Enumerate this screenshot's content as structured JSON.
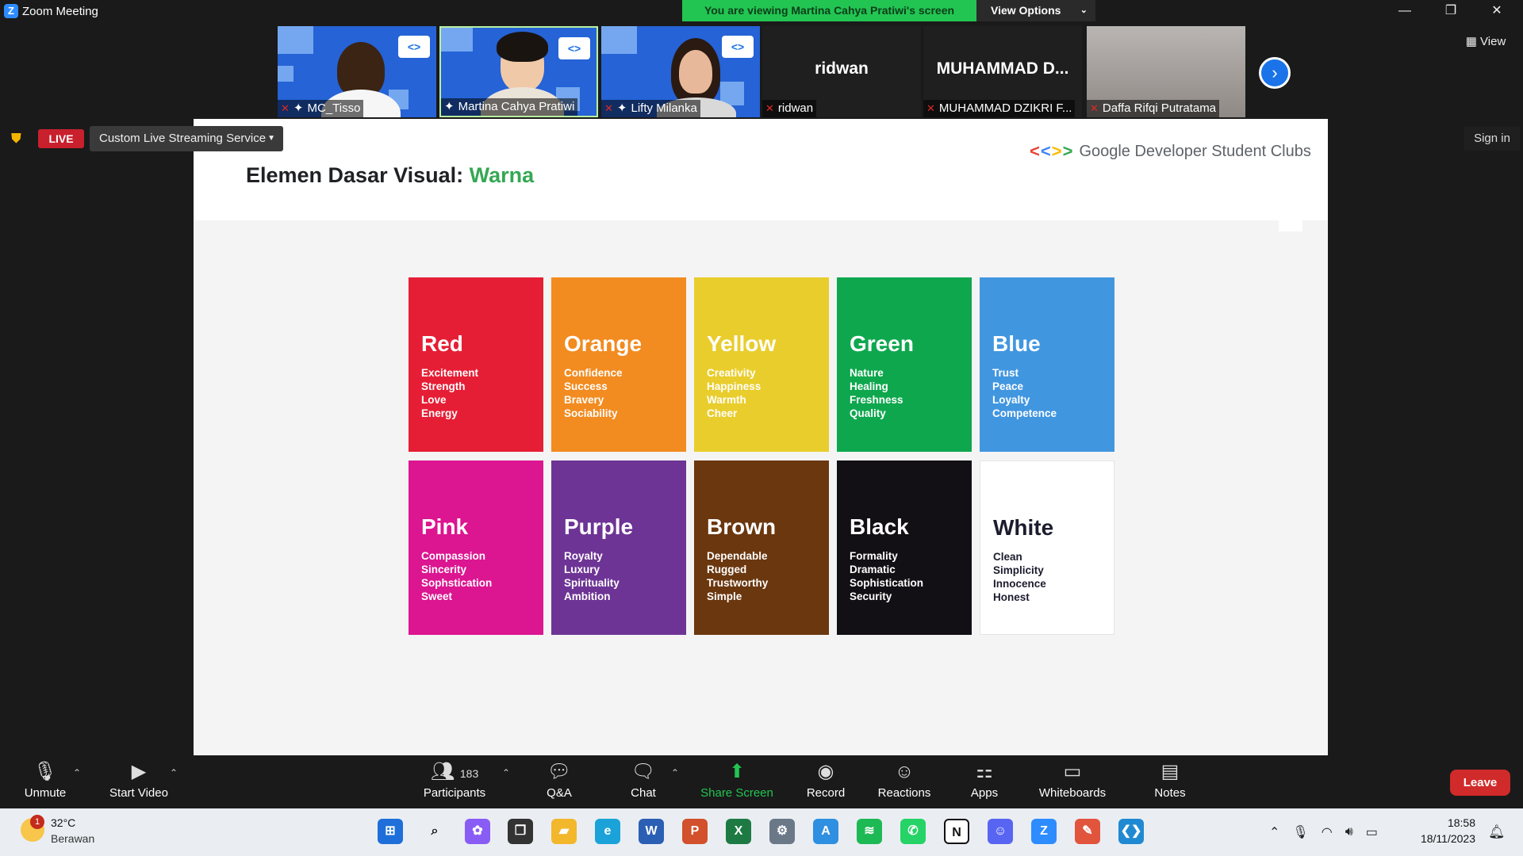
{
  "window": {
    "title": "Zoom Meeting",
    "logo": "Z"
  },
  "banner": {
    "viewing": "You are viewing Martina Cahya Pratiwi's screen",
    "view_options": "View Options"
  },
  "window_controls": {
    "minimize": "—",
    "restore": "❐",
    "close": "✕"
  },
  "thumbnails": [
    {
      "name": "MC_Tisso",
      "kind": "video"
    },
    {
      "name": "Martina Cahya Pratiwi",
      "kind": "video"
    },
    {
      "name": "Lifty Milanka",
      "kind": "video"
    },
    {
      "name": "ridwan",
      "display": "ridwan",
      "kind": "name"
    },
    {
      "name": "MUHAMMAD DZIKRI F...",
      "display": "MUHAMMAD D...",
      "kind": "name"
    },
    {
      "name": "Daffa Rifqi Putratama",
      "kind": "blurred"
    }
  ],
  "view_button": "View",
  "live": {
    "badge": "LIVE",
    "service": "Custom Live Streaming Service"
  },
  "sign_in": "Sign in",
  "slide": {
    "title_prefix": "Elemen Dasar Visual: ",
    "title_accent": "Warna",
    "brand": "Google Developer Student Clubs",
    "colors": [
      {
        "name": "Red",
        "bg": "#e61e35",
        "fg": "#ffffff",
        "traits": [
          "Excitement",
          "Strength",
          "Love",
          "Energy"
        ]
      },
      {
        "name": "Orange",
        "bg": "#f28b20",
        "fg": "#ffffff",
        "traits": [
          "Confidence",
          "Success",
          "Bravery",
          "Sociability"
        ]
      },
      {
        "name": "Yellow",
        "bg": "#e9cd2c",
        "fg": "#ffffff",
        "traits": [
          "Creativity",
          "Happiness",
          "Warmth",
          "Cheer"
        ]
      },
      {
        "name": "Green",
        "bg": "#0ea74e",
        "fg": "#ffffff",
        "traits": [
          "Nature",
          "Healing",
          "Freshness",
          "Quality"
        ]
      },
      {
        "name": "Blue",
        "bg": "#4196e0",
        "fg": "#ffffff",
        "traits": [
          "Trust",
          "Peace",
          "Loyalty",
          "Competence"
        ]
      },
      {
        "name": "Pink",
        "bg": "#dc1591",
        "fg": "#ffffff",
        "traits": [
          "Compassion",
          "Sincerity",
          "Sophstication",
          "Sweet"
        ]
      },
      {
        "name": "Purple",
        "bg": "#6d3495",
        "fg": "#ffffff",
        "traits": [
          "Royalty",
          "Luxury",
          "Spirituality",
          "Ambition"
        ]
      },
      {
        "name": "Brown",
        "bg": "#6b370f",
        "fg": "#ffffff",
        "traits": [
          "Dependable",
          "Rugged",
          "Trustworthy",
          "Simple"
        ]
      },
      {
        "name": "Black",
        "bg": "#121015",
        "fg": "#ffffff",
        "traits": [
          "Formality",
          "Dramatic",
          "Sophistication",
          "Security"
        ]
      },
      {
        "name": "White",
        "bg": "#ffffff",
        "fg": "#1c1c2e",
        "traits": [
          "Clean",
          "Simplicity",
          "Innocence",
          "Honest"
        ]
      }
    ]
  },
  "toolbar": {
    "unmute": "Unmute",
    "start_video": "Start Video",
    "participants": "Participants",
    "participants_count": "183",
    "qa": "Q&A",
    "chat": "Chat",
    "share_screen": "Share Screen",
    "record": "Record",
    "reactions": "Reactions",
    "apps": "Apps",
    "whiteboards": "Whiteboards",
    "notes": "Notes",
    "leave": "Leave"
  },
  "taskbar": {
    "weather_badge": "1",
    "temperature": "32°C",
    "weather": "Berawan",
    "time": "18:58",
    "date": "18/11/2023",
    "apps": [
      {
        "name": "start-icon",
        "color": "#1e6fd9"
      },
      {
        "name": "search-icon",
        "color": "#eaeef3"
      },
      {
        "name": "copilot-icon",
        "color": "#8a5cf6"
      },
      {
        "name": "task-view-icon",
        "color": "#333333"
      },
      {
        "name": "file-explorer-icon",
        "color": "#f3b72c"
      },
      {
        "name": "edge-icon",
        "color": "#1ba3d9"
      },
      {
        "name": "word-icon",
        "color": "#2b5fb4"
      },
      {
        "name": "powerpoint-icon",
        "color": "#d2502b"
      },
      {
        "name": "excel-icon",
        "color": "#1d7a43"
      },
      {
        "name": "settings-icon",
        "color": "#6b7888"
      },
      {
        "name": "affinity-icon",
        "color": "#2f8fe0"
      },
      {
        "name": "spotify-icon",
        "color": "#1db954"
      },
      {
        "name": "whatsapp-icon",
        "color": "#25d366"
      },
      {
        "name": "notion-icon",
        "color": "#ffffff"
      },
      {
        "name": "discord-icon",
        "color": "#5865f2"
      },
      {
        "name": "zoom-icon",
        "color": "#2d8cff"
      },
      {
        "name": "paint-icon",
        "color": "#e2553d"
      },
      {
        "name": "vscode-icon",
        "color": "#1f8ad2"
      }
    ]
  }
}
